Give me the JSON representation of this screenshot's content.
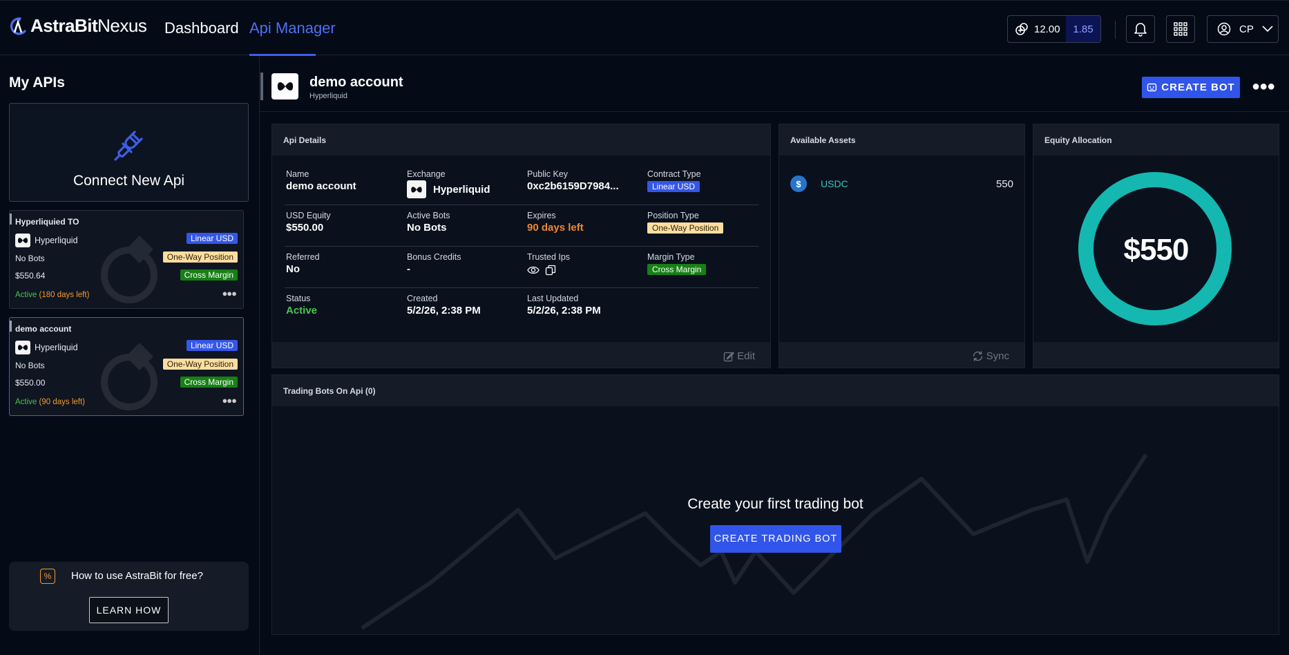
{
  "app": {
    "logo_bold": "AstraBit",
    "logo_light": "Nexus",
    "nav": {
      "dashboard": "Dashboard",
      "api_manager": "Api Manager"
    },
    "credits_main": "12.00",
    "credits_secondary": "1.85",
    "user_initials": "CP"
  },
  "sidebar": {
    "title": "My APIs",
    "connect_label": "Connect New Api",
    "cards": [
      {
        "name": "Hyperliquied TO",
        "exchange": "Hyperliquid",
        "contract": "Linear USD",
        "bots": "No Bots",
        "position": "One-Way Position",
        "equity": "$550.64",
        "margin": "Cross Margin",
        "status": "Active",
        "days": "(180 days left)"
      },
      {
        "name": "demo account",
        "exchange": "Hyperliquid",
        "contract": "Linear USD",
        "bots": "No Bots",
        "position": "One-Way Position",
        "equity": "$550.00",
        "margin": "Cross Margin",
        "status": "Active",
        "days": "(90 days left)"
      }
    ],
    "promo": {
      "text": "How to use AstraBit for free?",
      "button": "LEARN HOW"
    }
  },
  "header": {
    "title": "demo account",
    "subtitle": "Hyperliquid",
    "create_bot": "CREATE BOT"
  },
  "api_details": {
    "title": "Api Details",
    "name_label": "Name",
    "name": "demo account",
    "exchange_label": "Exchange",
    "exchange": "Hyperliquid",
    "public_key_label": "Public Key",
    "public_key": "0xc2b6159D7984...",
    "contract_label": "Contract Type",
    "contract": "Linear USD",
    "equity_label": "USD Equity",
    "equity": "$550.00",
    "active_bots_label": "Active Bots",
    "active_bots": "No Bots",
    "expires_label": "Expires",
    "expires": "90 days left",
    "position_label": "Position Type",
    "position": "One-Way Position",
    "referred_label": "Referred",
    "referred": "No",
    "bonus_label": "Bonus Credits",
    "bonus": "-",
    "trusted_label": "Trusted Ips",
    "margin_label": "Margin Type",
    "margin": "Cross Margin",
    "status_label": "Status",
    "status": "Active",
    "created_label": "Created",
    "created": "5/2/26, 2:38 PM",
    "updated_label": "Last Updated",
    "updated": "5/2/26, 2:38 PM",
    "edit": "Edit"
  },
  "assets": {
    "title": "Available Assets",
    "items": [
      {
        "symbol": "USDC",
        "amount": "550"
      }
    ],
    "sync": "Sync"
  },
  "equity_allocation": {
    "title": "Equity Allocation",
    "total": "$550",
    "ring_color": "#14b8b1"
  },
  "bots": {
    "title": "Trading Bots On Api (0)",
    "empty_text": "Create your first trading bot",
    "button": "CREATE TRADING BOT"
  },
  "colors": {
    "accent": "#3155ea",
    "active_green": "#4dc44f",
    "warning_orange": "#f3862f",
    "background": "#040b17"
  }
}
